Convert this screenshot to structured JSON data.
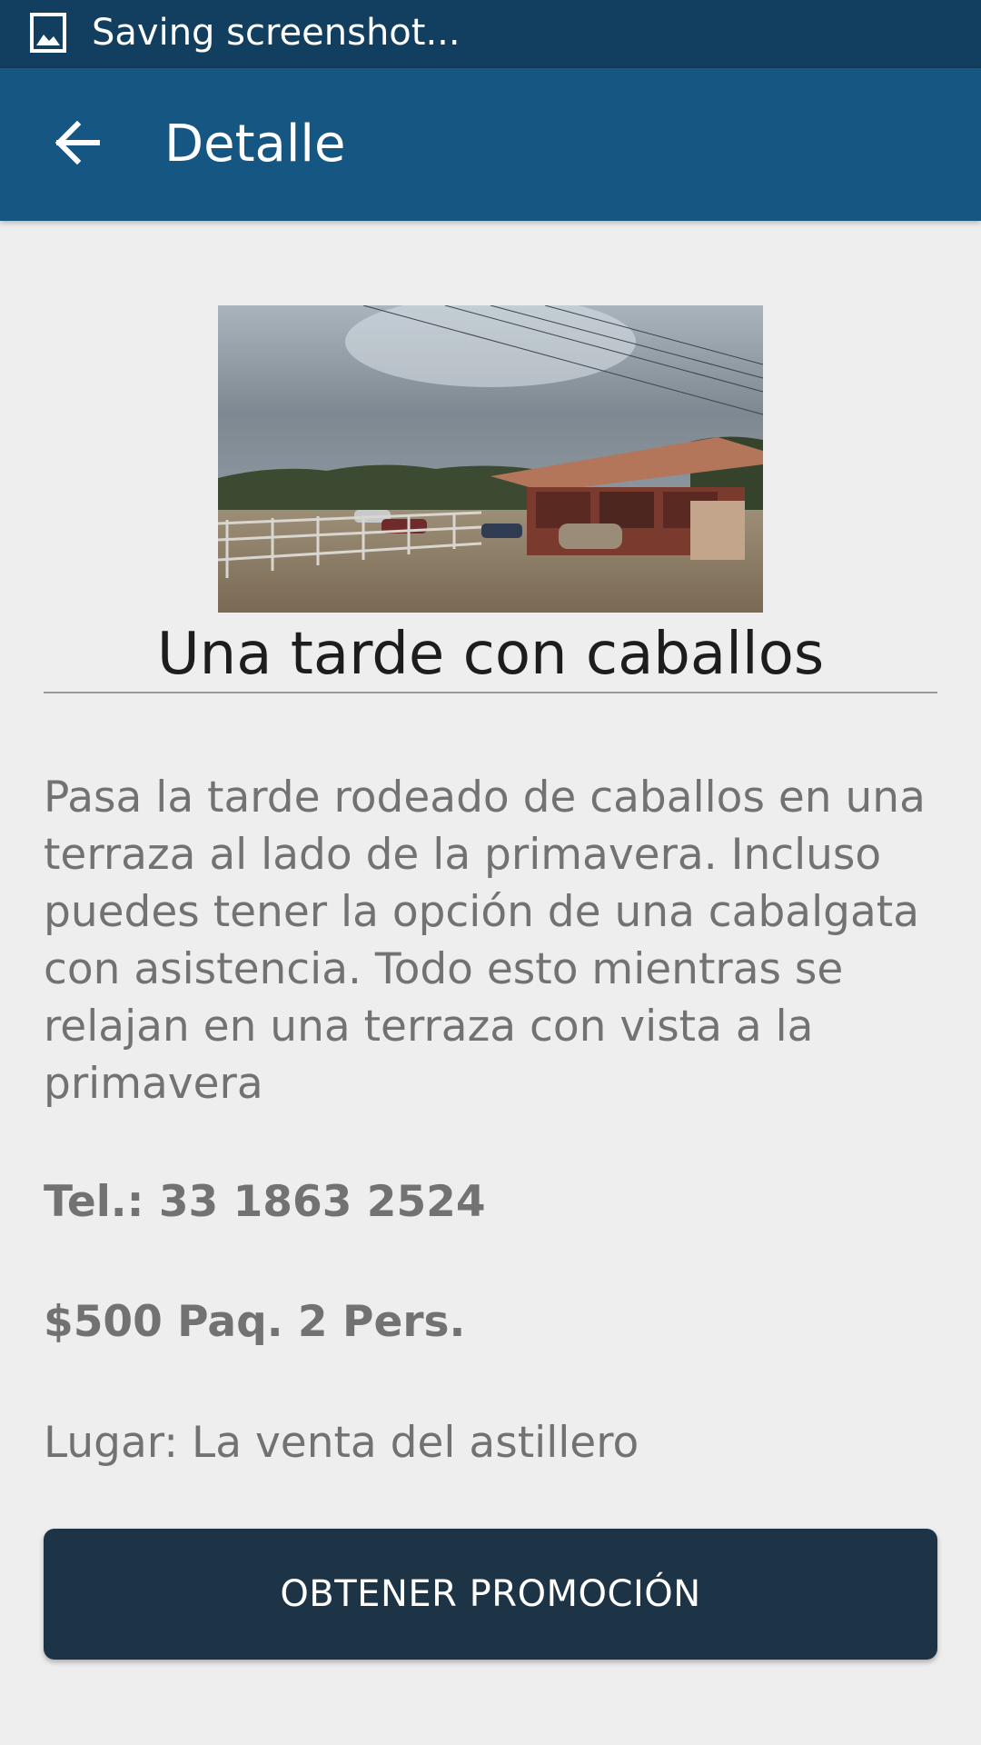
{
  "status_bar": {
    "icon": "gallery-icon",
    "text": "Saving screenshot..."
  },
  "app_bar": {
    "back_icon": "arrow-left-icon",
    "title": "Detalle"
  },
  "promo": {
    "image": "horse-ranch-photo",
    "title": "Una tarde con caballos",
    "description": "Pasa la tarde rodeado de caballos en una terraza al lado de la primavera. Incluso puedes tener la opción de una cabalgata con asistencia. Todo esto mientras se relajan en una terraza con vista a la primavera",
    "phone": "Tel.: 33 1863 2524",
    "price": "$500 Paq. 2 Pers.",
    "location": "Lugar: La venta del astillero",
    "button_label": "OBTENER PROMOCIÓN"
  },
  "colors": {
    "status_bar": "#123e5f",
    "app_bar": "#155682",
    "background": "#eeeeef",
    "button": "#1d3447"
  }
}
